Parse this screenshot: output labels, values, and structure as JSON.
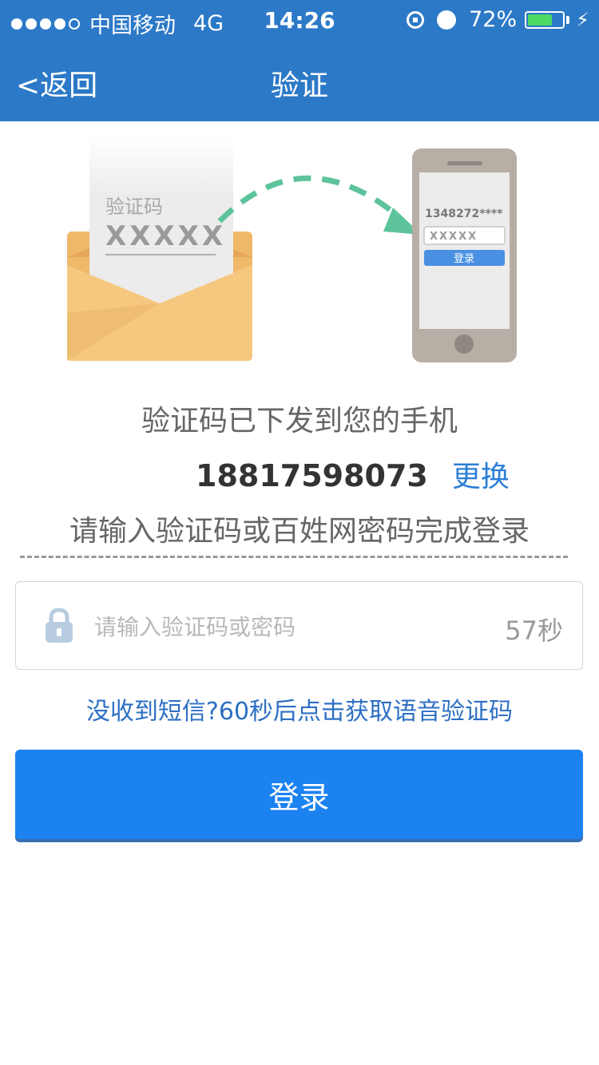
{
  "status_bar": {
    "carrier": "中国移动",
    "network": "4G",
    "time": "14:26",
    "battery_percent": "72%",
    "battery_level": 0.72,
    "signal_bars_filled": 4,
    "signal_bars_total": 5
  },
  "nav": {
    "back_label": "<返回",
    "title": "验证"
  },
  "illustration": {
    "envelope_label": "验证码",
    "envelope_code": "XXXXX",
    "phone_number_masked": "1348272****",
    "phone_code": "XXXXX",
    "phone_button": "登录"
  },
  "main": {
    "sent_message": "验证码已下发到您的手机",
    "phone_number": "18817598073",
    "change_link": "更换",
    "instruction": "请输入验证码或百姓网密码完成登录"
  },
  "code_input": {
    "placeholder": "请输入验证码或密码",
    "value": "",
    "countdown": "57秒"
  },
  "voice_link": "没收到短信?60秒后点击获取语音验证码",
  "login_button": "登录",
  "colors": {
    "header": "#2c79c7",
    "primary_button": "#1b82f0",
    "link": "#2c7fd7",
    "envelope": "#f5c77e",
    "arrow": "#5cc39a"
  }
}
